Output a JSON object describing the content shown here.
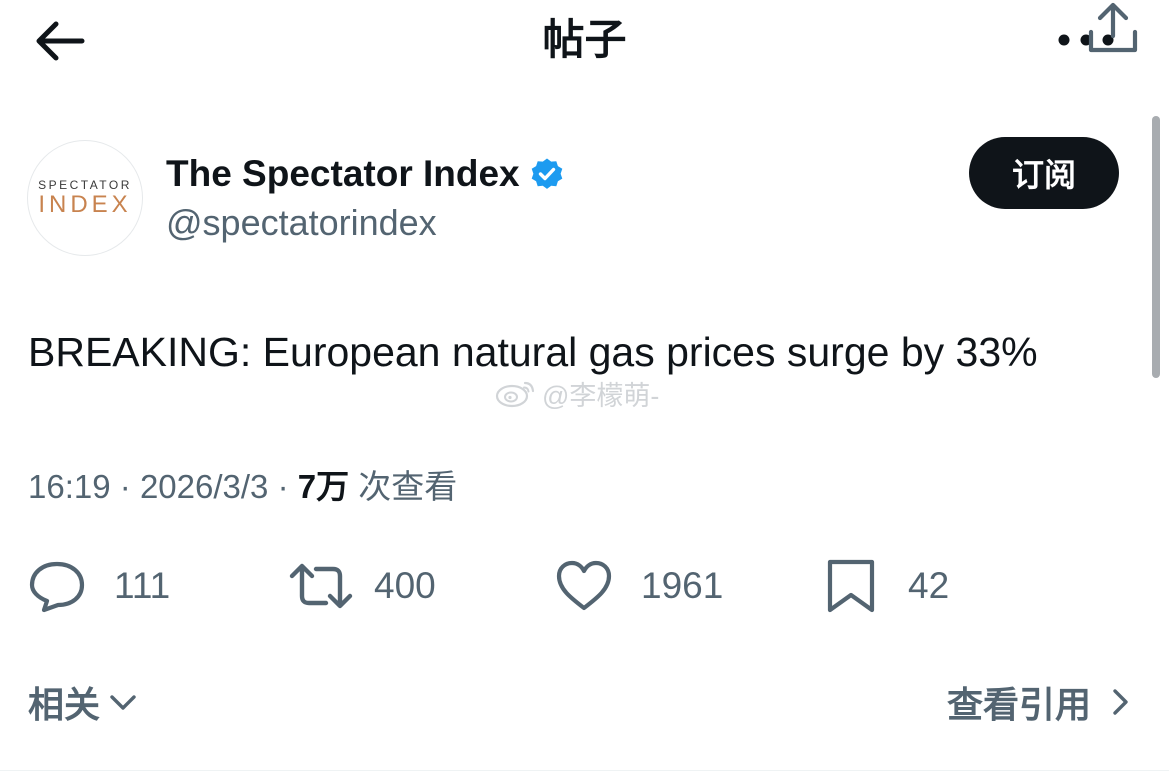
{
  "header": {
    "title": "帖子",
    "back_icon": "arrow-left-icon",
    "more_icon": "more-horizontal-icon"
  },
  "author": {
    "name": "The Spectator Index",
    "handle": "@spectatorindex",
    "verified_icon": "verified-badge-icon",
    "verified_color": "#1d9bf0",
    "avatar": {
      "line1": "SPECTATOR",
      "line2": "INDEX",
      "line2_color": "#c8834f"
    }
  },
  "subscribe_label": "订阅",
  "tweet": {
    "text": "BREAKING: European natural gas prices surge by 33%"
  },
  "watermark": {
    "text": "@李檬萌-",
    "icon": "weibo-icon"
  },
  "meta": {
    "time": "16:19",
    "sep": "·",
    "date": "2026/3/3",
    "views_count": "7万",
    "views_label": "次查看"
  },
  "actions": {
    "reply": {
      "count": "111",
      "icon": "reply-icon"
    },
    "retweet": {
      "count": "400",
      "icon": "retweet-icon"
    },
    "like": {
      "count": "1961",
      "icon": "heart-icon"
    },
    "bookmark": {
      "count": "42",
      "icon": "bookmark-icon"
    },
    "share": {
      "icon": "share-icon"
    }
  },
  "footer": {
    "related_label": "相关",
    "view_quotes_label": "查看引用"
  },
  "colors": {
    "text": "#0f1419",
    "secondary": "#536471",
    "button_bg": "#0f1419"
  }
}
